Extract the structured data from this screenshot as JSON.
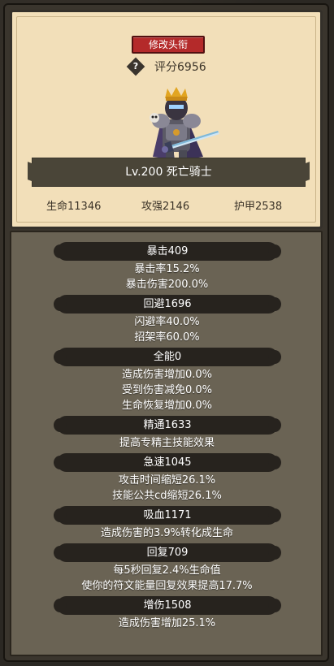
{
  "header": {
    "change_title_button": "修改头衔",
    "rating_icon": "question-diamond-icon",
    "rating": "评分6956",
    "hero_name": "Lv.200 死亡骑士",
    "stats": {
      "hp": "生命11346",
      "attack": "攻强2146",
      "armor": "护甲2538"
    }
  },
  "sections": [
    {
      "title": "暴击409",
      "lines": [
        "暴击率15.2%",
        "暴击伤害200.0%"
      ]
    },
    {
      "title": "回避1696",
      "lines": [
        "闪避率40.0%",
        "招架率60.0%"
      ]
    },
    {
      "title": "全能0",
      "lines": [
        "造成伤害增加0.0%",
        "受到伤害减免0.0%",
        "生命恢复增加0.0%"
      ]
    },
    {
      "title": "精通1633",
      "lines": [
        "提高专精主技能效果"
      ]
    },
    {
      "title": "急速1045",
      "lines": [
        "攻击时间缩短26.1%",
        "技能公共cd缩短26.1%"
      ]
    },
    {
      "title": "吸血1171",
      "lines": [
        "造成伤害的3.9%转化成生命"
      ]
    },
    {
      "title": "回复709",
      "lines": [
        "每5秒回复2.4%生命值",
        "使你的符文能量回复效果提高17.7%"
      ]
    },
    {
      "title": "增伤1508",
      "lines": [
        "造成伤害增加25.1%"
      ]
    }
  ]
}
